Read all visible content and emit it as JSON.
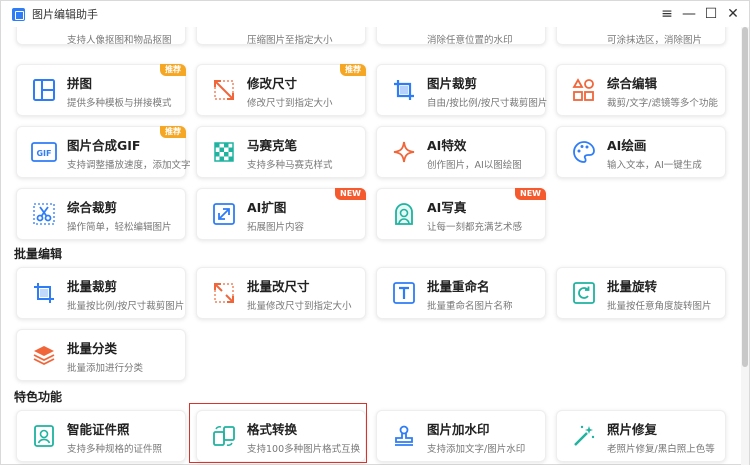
{
  "window": {
    "title": "图片编辑助手",
    "controls": [
      "≡",
      "—",
      "☐",
      "✕"
    ]
  },
  "top_row": [
    {
      "desc": "支持人像抠图和物品抠图"
    },
    {
      "desc": "压缩图片至指定大小"
    },
    {
      "desc": "消除任意位置的水印"
    },
    {
      "desc": "可涂抹选区，消除图片"
    }
  ],
  "tools": [
    {
      "title": "拼图",
      "desc": "提供多种模板与拼接模式",
      "badge": "推荐",
      "icon": "puzzle-layout-icon"
    },
    {
      "title": "修改尺寸",
      "desc": "修改尺寸到指定大小",
      "badge": "推荐",
      "icon": "resize-arrows-icon"
    },
    {
      "title": "图片裁剪",
      "desc": "自由/按比例/按尺寸裁剪图片",
      "icon": "crop-icon"
    },
    {
      "title": "综合编辑",
      "desc": "裁剪/文字/滤镜等多个功能",
      "icon": "shapes-icon"
    },
    {
      "title": "图片合成GIF",
      "desc": "支持调整播放速度，添加文字",
      "badge": "推荐",
      "icon": "gif-icon"
    },
    {
      "title": "马赛克笔",
      "desc": "支持多种马赛克样式",
      "icon": "mosaic-icon"
    },
    {
      "title": "AI特效",
      "desc": "创作图片，AI以图绘图",
      "icon": "sparkle-icon"
    },
    {
      "title": "AI绘画",
      "desc": "输入文本，AI一键生成",
      "icon": "palette-icon"
    },
    {
      "title": "综合裁剪",
      "desc": "操作简单，轻松编辑图片",
      "icon": "scissors-icon"
    },
    {
      "title": "AI扩图",
      "desc": "拓展图片内容",
      "badge": "NEW",
      "icon": "expand-icon"
    },
    {
      "title": "AI写真",
      "desc": "让每一刻都充满艺术感",
      "badge": "NEW",
      "icon": "portrait-icon"
    }
  ],
  "batch_section": {
    "title": "批量编辑",
    "items": [
      {
        "title": "批量裁剪",
        "desc": "批量按比例/按尺寸裁剪图片",
        "icon": "batch-crop-icon"
      },
      {
        "title": "批量改尺寸",
        "desc": "批量修改尺寸到指定大小",
        "icon": "batch-resize-icon"
      },
      {
        "title": "批量重命名",
        "desc": "批量重命名图片名称",
        "icon": "rename-icon"
      },
      {
        "title": "批量旋转",
        "desc": "批量按任意角度旋转图片",
        "icon": "rotate-icon"
      },
      {
        "title": "批量分类",
        "desc": "批量添加进行分类",
        "icon": "layers-icon"
      }
    ]
  },
  "feature_section": {
    "title": "特色功能",
    "items": [
      {
        "title": "智能证件照",
        "desc": "支持多种规格的证件照",
        "icon": "id-photo-icon"
      },
      {
        "title": "格式转换",
        "desc": "支持100多种图片格式互换",
        "icon": "convert-icon"
      },
      {
        "title": "图片加水印",
        "desc": "支持添加文字/图片水印",
        "icon": "stamp-icon"
      },
      {
        "title": "照片修复",
        "desc": "老照片修复/黑白照上色等",
        "icon": "magic-wand-icon"
      }
    ]
  },
  "colors": {
    "accent_blue": "#2f7df6",
    "orange": "#f5a623",
    "coral": "#f0663a",
    "teal": "#1fb3a0",
    "highlight_red": "#d9342b"
  }
}
